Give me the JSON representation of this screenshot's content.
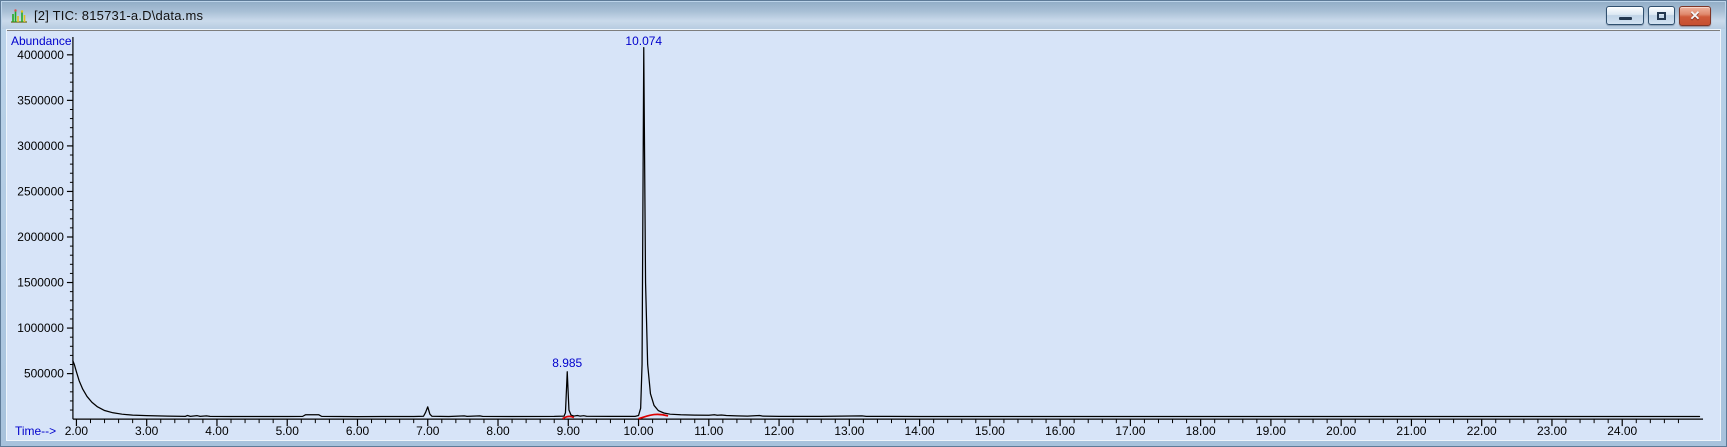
{
  "window": {
    "title": "[2] TIC: 815731-a.D\\data.ms",
    "icon": "chromatogram-app-icon",
    "controls": {
      "minimize_glyph": "—",
      "restore_glyph": "❐",
      "close_glyph": "✕"
    }
  },
  "colors": {
    "client_background": "#d7e4f8",
    "titlebar_top": "#93aec7",
    "titlebar_bottom": "#b7cce1",
    "axis": "#000000",
    "trace": "#000000",
    "blue_labels": "#0000cc",
    "integration_red": "#dd0000",
    "close_button_red": "#c64f30"
  },
  "chart_data": {
    "type": "line",
    "title": "TIC: 815731-a.D\\data.ms",
    "xlabel": "Time-->",
    "ylabel": "Abundance",
    "xlim": [
      1.95,
      25.15
    ],
    "ylim": [
      0,
      4383000
    ],
    "grid": false,
    "legend": "none",
    "x_major_ticks": [
      2,
      3,
      4,
      5,
      6,
      7,
      8,
      9,
      10,
      11,
      12,
      13,
      14,
      15,
      16,
      17,
      18,
      19,
      20,
      21,
      22,
      23,
      24
    ],
    "x_major_tick_labels": [
      "2.00",
      "3.00",
      "4.00",
      "5.00",
      "6.00",
      "7.00",
      "8.00",
      "9.00",
      "10.00",
      "11.00",
      "12.00",
      "13.00",
      "14.00",
      "15.00",
      "16.00",
      "17.00",
      "18.00",
      "19.00",
      "20.00",
      "21.00",
      "22.00",
      "23.00",
      "24.00"
    ],
    "x_minor_step": 0.2,
    "y_major_ticks": [
      500000,
      1000000,
      1500000,
      2000000,
      2500000,
      3000000,
      3500000,
      4000000
    ],
    "y_major_tick_labels": [
      "500000",
      "1000000",
      "1500000",
      "2000000",
      "2500000",
      "3000000",
      "3500000",
      "4000000"
    ],
    "y_minor_step": 100000,
    "peaks": [
      {
        "retention_time": 8.985,
        "label": "8.985",
        "apex_abundance": 520000
      },
      {
        "retention_time": 10.074,
        "label": "10.074",
        "apex_abundance": 4080000
      }
    ],
    "trace": [
      [
        1.95,
        640000
      ],
      [
        1.97,
        600000
      ],
      [
        2.0,
        520000
      ],
      [
        2.04,
        420000
      ],
      [
        2.09,
        330000
      ],
      [
        2.15,
        250000
      ],
      [
        2.22,
        185000
      ],
      [
        2.3,
        135000
      ],
      [
        2.4,
        95000
      ],
      [
        2.52,
        70000
      ],
      [
        2.65,
        55000
      ],
      [
        2.8,
        45000
      ],
      [
        3.0,
        38000
      ],
      [
        3.3,
        33000
      ],
      [
        3.55,
        31000
      ],
      [
        3.58,
        40000
      ],
      [
        3.62,
        31000
      ],
      [
        3.72,
        38000
      ],
      [
        3.76,
        31000
      ],
      [
        3.85,
        36000
      ],
      [
        3.9,
        30000
      ],
      [
        4.2,
        29000
      ],
      [
        5.0,
        29000
      ],
      [
        5.22,
        30000
      ],
      [
        5.26,
        48000
      ],
      [
        5.45,
        48000
      ],
      [
        5.49,
        30000
      ],
      [
        6.0,
        28000
      ],
      [
        6.8,
        29000
      ],
      [
        6.94,
        32000
      ],
      [
        6.97,
        75000
      ],
      [
        7.0,
        135000
      ],
      [
        7.03,
        55000
      ],
      [
        7.06,
        32000
      ],
      [
        7.3,
        29000
      ],
      [
        7.52,
        36000
      ],
      [
        7.56,
        30000
      ],
      [
        7.74,
        36000
      ],
      [
        7.78,
        30000
      ],
      [
        8.2,
        29000
      ],
      [
        8.8,
        30000
      ],
      [
        8.94,
        34000
      ],
      [
        8.96,
        70000
      ],
      [
        8.985,
        520000
      ],
      [
        9.01,
        100000
      ],
      [
        9.04,
        45000
      ],
      [
        9.08,
        34000
      ],
      [
        9.13,
        40000
      ],
      [
        9.17,
        33000
      ],
      [
        9.22,
        38000
      ],
      [
        9.26,
        32000
      ],
      [
        9.6,
        30000
      ],
      [
        9.95,
        31000
      ],
      [
        10.0,
        40000
      ],
      [
        10.03,
        120000
      ],
      [
        10.05,
        600000
      ],
      [
        10.074,
        4080000
      ],
      [
        10.1,
        1500000
      ],
      [
        10.13,
        600000
      ],
      [
        10.17,
        280000
      ],
      [
        10.22,
        150000
      ],
      [
        10.28,
        95000
      ],
      [
        10.36,
        68000
      ],
      [
        10.45,
        55000
      ],
      [
        10.6,
        48000
      ],
      [
        10.8,
        44000
      ],
      [
        11.0,
        42000
      ],
      [
        11.08,
        48000
      ],
      [
        11.12,
        42000
      ],
      [
        11.18,
        46000
      ],
      [
        11.25,
        40000
      ],
      [
        11.4,
        36000
      ],
      [
        11.55,
        34000
      ],
      [
        11.72,
        40000
      ],
      [
        11.77,
        33000
      ],
      [
        12.0,
        31000
      ],
      [
        12.6,
        30000
      ],
      [
        13.18,
        36000
      ],
      [
        13.24,
        30000
      ],
      [
        14.0,
        29000
      ],
      [
        16.0,
        29000
      ],
      [
        18.0,
        29000
      ],
      [
        20.0,
        29000
      ],
      [
        22.0,
        29000
      ],
      [
        24.0,
        29000
      ],
      [
        25.1,
        29000
      ]
    ],
    "integration_baselines": [
      {
        "points": [
          [
            8.92,
            6000
          ],
          [
            8.97,
            30000
          ],
          [
            9.02,
            42000
          ],
          [
            9.08,
            18000
          ]
        ]
      },
      {
        "points": [
          [
            10.0,
            5000
          ],
          [
            10.12,
            30000
          ],
          [
            10.22,
            78000
          ],
          [
            10.42,
            36000
          ]
        ]
      }
    ]
  }
}
